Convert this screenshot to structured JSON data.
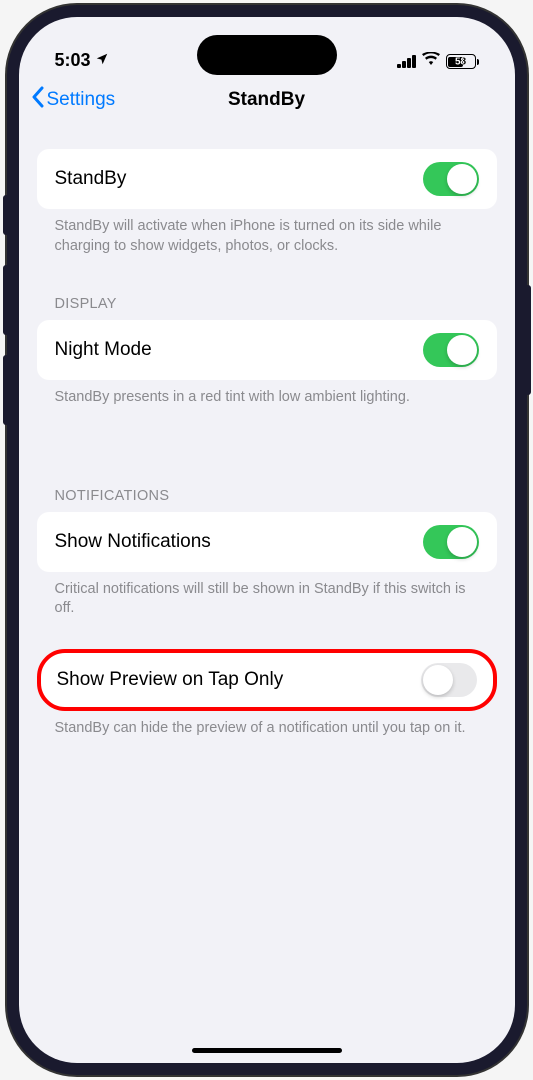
{
  "status": {
    "time": "5:03",
    "battery": "58"
  },
  "nav": {
    "back": "Settings",
    "title": "StandBy"
  },
  "standby": {
    "label": "StandBy",
    "on": true,
    "footer": "StandBy will activate when iPhone is turned on its side while charging to show widgets, photos, or clocks."
  },
  "display": {
    "header": "DISPLAY",
    "night_mode": {
      "label": "Night Mode",
      "on": true,
      "footer": "StandBy presents in a red tint with low ambient lighting."
    }
  },
  "notifications": {
    "header": "NOTIFICATIONS",
    "show": {
      "label": "Show Notifications",
      "on": true,
      "footer": "Critical notifications will still be shown in StandBy if this switch is off."
    },
    "preview": {
      "label": "Show Preview on Tap Only",
      "on": false,
      "footer": "StandBy can hide the preview of a notification until you tap on it."
    }
  }
}
